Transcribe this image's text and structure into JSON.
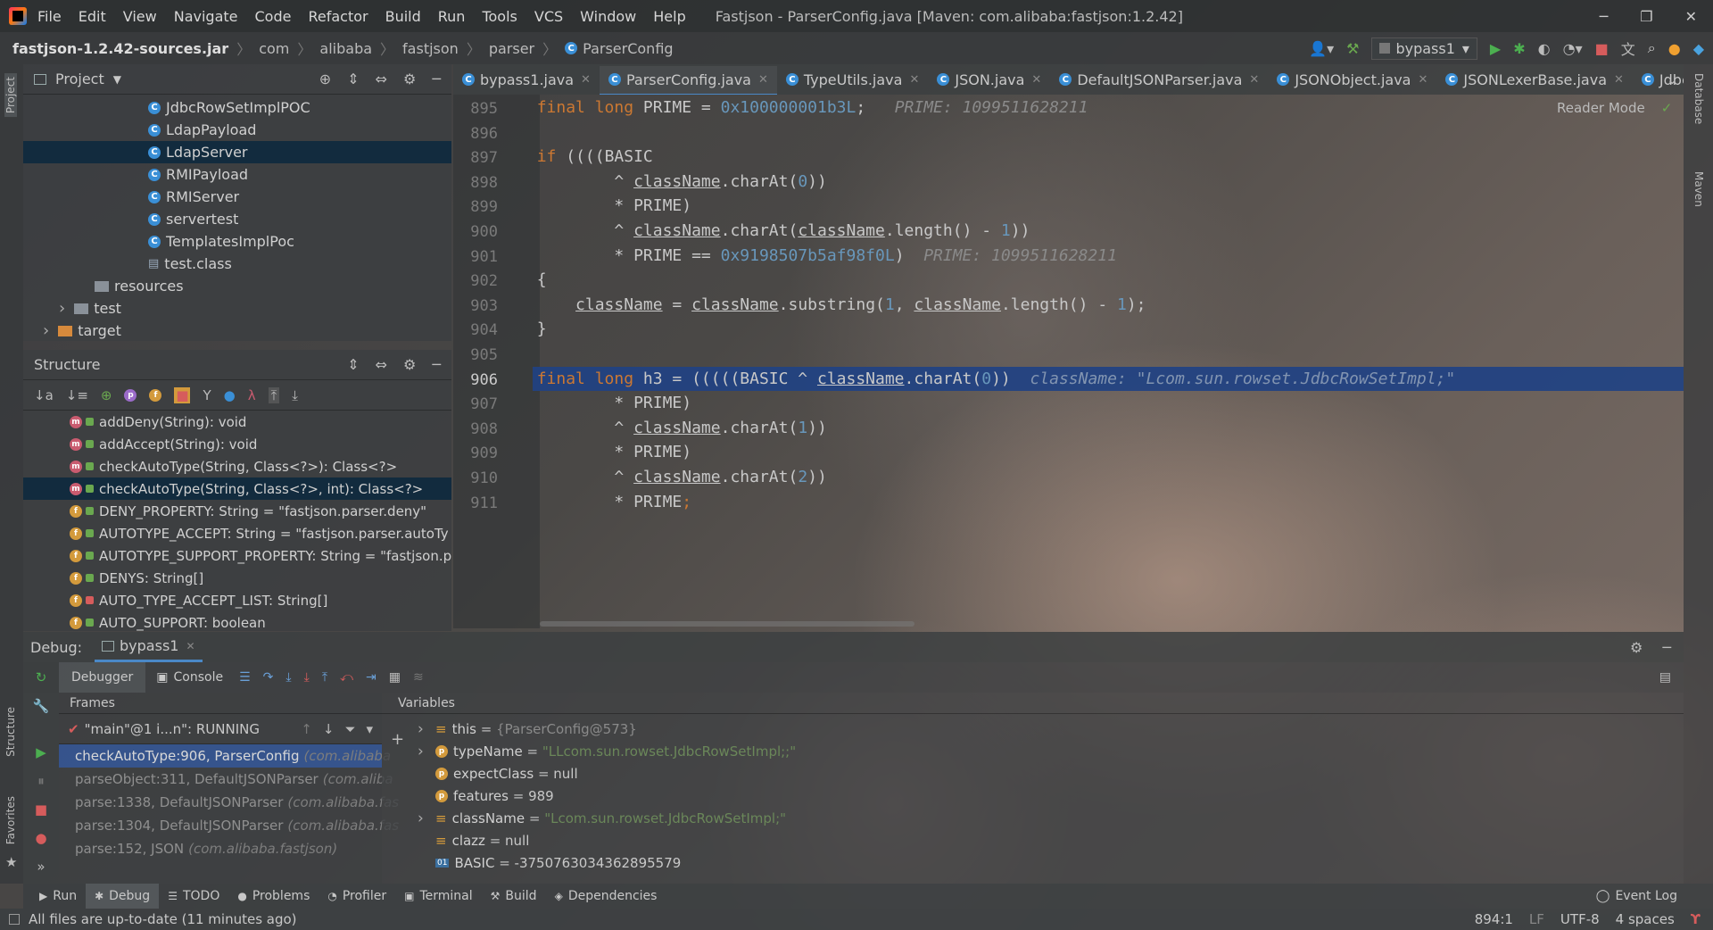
{
  "titlebar": {
    "menu": [
      "File",
      "Edit",
      "View",
      "Navigate",
      "Code",
      "Refactor",
      "Build",
      "Run",
      "Tools",
      "VCS",
      "Window",
      "Help"
    ],
    "title": "Fastjson - ParserConfig.java [Maven: com.alibaba:fastjson:1.2.42]"
  },
  "navbar": {
    "crumbs": [
      "fastjson-1.2.42-sources.jar",
      "com",
      "alibaba",
      "fastjson",
      "parser",
      "ParserConfig"
    ],
    "run_config": "bypass1"
  },
  "project": {
    "title": "Project",
    "items": [
      {
        "label": "JdbcRowSetImplPOC",
        "type": "class",
        "indent": 1
      },
      {
        "label": "LdapPayload",
        "type": "class",
        "indent": 1
      },
      {
        "label": "LdapServer",
        "type": "class",
        "indent": 1,
        "selected": true
      },
      {
        "label": "RMIPayload",
        "type": "class",
        "indent": 1
      },
      {
        "label": "RMIServer",
        "type": "class",
        "indent": 1
      },
      {
        "label": "servertest",
        "type": "class",
        "indent": 1
      },
      {
        "label": "TemplatesImplPoc",
        "type": "class",
        "indent": 1
      },
      {
        "label": "test.class",
        "type": "file",
        "indent": 1
      },
      {
        "label": "resources",
        "type": "folder",
        "indent": 0
      },
      {
        "label": "test",
        "type": "folder",
        "indent": -1
      },
      {
        "label": "target",
        "type": "folder-orange",
        "indent": -2
      }
    ]
  },
  "structure": {
    "title": "Structure",
    "items": [
      {
        "label": "addDeny(String): void",
        "kind": "m"
      },
      {
        "label": "addAccept(String): void",
        "kind": "m"
      },
      {
        "label": "checkAutoType(String, Class<?>): Class<?>",
        "kind": "m"
      },
      {
        "label": "checkAutoType(String, Class<?>, int): Class<?>",
        "kind": "m",
        "selected": true
      },
      {
        "label": "DENY_PROPERTY: String = \"fastjson.parser.deny\"",
        "kind": "f"
      },
      {
        "label": "AUTOTYPE_ACCEPT: String = \"fastjson.parser.autoTy",
        "kind": "f"
      },
      {
        "label": "AUTOTYPE_SUPPORT_PROPERTY: String = \"fastjson.p",
        "kind": "f"
      },
      {
        "label": "DENYS: String[]",
        "kind": "f"
      },
      {
        "label": "AUTO_TYPE_ACCEPT_LIST: String[]",
        "kind": "f",
        "private": true
      },
      {
        "label": "AUTO_SUPPORT: boolean",
        "kind": "f"
      }
    ]
  },
  "tabs": [
    {
      "label": "bypass1.java",
      "active": false
    },
    {
      "label": "ParserConfig.java",
      "active": true
    },
    {
      "label": "TypeUtils.java",
      "active": false
    },
    {
      "label": "JSON.java",
      "active": false
    },
    {
      "label": "DefaultJSONParser.java",
      "active": false
    },
    {
      "label": "JSONObject.java",
      "active": false
    },
    {
      "label": "JSONLexerBase.java",
      "active": false
    },
    {
      "label": "JdbcRo",
      "active": false
    }
  ],
  "editor": {
    "reader_mode": "Reader Mode",
    "lines": [
      {
        "n": "895",
        "html": "        <span class='kw'>final long</span> PRIME = <span class='num'>0x100000001b3L</span>;   <span class='hint'>PRIME: 1099511628211</span>"
      },
      {
        "n": "896",
        "html": ""
      },
      {
        "n": "897",
        "html": "        <span class='kw'>if</span> ((((BASIC"
      },
      {
        "n": "898",
        "html": "                ^ <span class='var'>className</span>.charAt(<span class='num'>0</span>))"
      },
      {
        "n": "899",
        "html": "                * PRIME)"
      },
      {
        "n": "900",
        "html": "                ^ <span class='var'>className</span>.charAt(<span class='var'>className</span>.length() - <span class='num'>1</span>))"
      },
      {
        "n": "901",
        "html": "                * PRIME == <span class='num'>0x9198507b5af98f0L</span>)  <span class='hint'>PRIME: 1099511628211</span>"
      },
      {
        "n": "902",
        "html": "        {"
      },
      {
        "n": "903",
        "html": "            <span class='var'>className</span> = <span class='var'>className</span>.substring(<span class='num'>1</span>, <span class='var'>className</span>.length() - <span class='num'>1</span>);"
      },
      {
        "n": "904",
        "html": "        }"
      },
      {
        "n": "905",
        "html": ""
      },
      {
        "n": "906",
        "html": "        <span class='kw'>final long</span> h3 = (((((BASIC ^ <span class='var'>className</span>.charAt(<span class='num'>0</span>))  <span class='hintb'>className: \"Lcom.sun.rowset.JdbcRowSetImpl;\"</span>",
        "current": true
      },
      {
        "n": "907",
        "html": "                * PRIME)"
      },
      {
        "n": "908",
        "html": "                ^ <span class='var'>className</span>.charAt(<span class='num'>1</span>))"
      },
      {
        "n": "909",
        "html": "                * PRIME)"
      },
      {
        "n": "910",
        "html": "                ^ <span class='var'>className</span>.charAt(<span class='num'>2</span>))"
      },
      {
        "n": "911",
        "html": "                * PRIME<span class='kw'>;</span>"
      }
    ]
  },
  "debug": {
    "label": "Debug:",
    "session": "bypass1",
    "tab_debugger": "Debugger",
    "tab_console": "Console",
    "frames_title": "Frames",
    "variables_title": "Variables",
    "thread": "\"main\"@1 i...n\": RUNNING",
    "frames": [
      {
        "method": "checkAutoType:906, ParserConfig",
        "pkg": "(com.alibaba",
        "selected": true
      },
      {
        "method": "parseObject:311, DefaultJSONParser",
        "pkg": "(com.aliba",
        "selected": false
      },
      {
        "method": "parse:1338, DefaultJSONParser",
        "pkg": "(com.alibaba.fas",
        "selected": false
      },
      {
        "method": "parse:1304, DefaultJSONParser",
        "pkg": "(com.alibaba.fas",
        "selected": false
      },
      {
        "method": "parse:152, JSON",
        "pkg": "(com.alibaba.fastjson)",
        "selected": false
      }
    ],
    "variables": [
      {
        "name": "this",
        "value": "{ParserConfig@573}",
        "kind": "obj",
        "expand": true
      },
      {
        "name": "typeName",
        "value": "\"LLcom.sun.rowset.JdbcRowSetImpl;;\"",
        "kind": "p",
        "expand": true,
        "str": true
      },
      {
        "name": "expectClass",
        "value": "null",
        "kind": "p",
        "expand": false
      },
      {
        "name": "features",
        "value": "989",
        "kind": "p",
        "expand": false
      },
      {
        "name": "className",
        "value": "\"Lcom.sun.rowset.JdbcRowSetImpl;\"",
        "kind": "obj",
        "expand": true,
        "str": true
      },
      {
        "name": "clazz",
        "value": "null",
        "kind": "obj",
        "expand": false
      },
      {
        "name": "BASIC",
        "value": "-3750763034362895579",
        "kind": "01",
        "expand": false
      }
    ]
  },
  "bottom_tabs": [
    {
      "label": "Run",
      "icon": "▶",
      "active": false
    },
    {
      "label": "Debug",
      "icon": "✱",
      "active": true
    },
    {
      "label": "TODO",
      "icon": "☰",
      "active": false
    },
    {
      "label": "Problems",
      "icon": "●",
      "active": false
    },
    {
      "label": "Profiler",
      "icon": "◔",
      "active": false
    },
    {
      "label": "Terminal",
      "icon": "▣",
      "active": false
    },
    {
      "label": "Build",
      "icon": "⚒",
      "active": false
    },
    {
      "label": "Dependencies",
      "icon": "◈",
      "active": false
    }
  ],
  "event_log": "Event Log",
  "status": {
    "message": "All files are up-to-date (11 minutes ago)",
    "position": "894:1",
    "line_sep": "LF",
    "encoding": "UTF-8",
    "indent": "4 spaces"
  },
  "side": {
    "project": "Project",
    "structure": "Structure",
    "favorites": "Favorites",
    "database": "Database",
    "maven": "Maven"
  },
  "colors": {
    "keyword": "#cc7832",
    "number": "#6897bb",
    "string": "#6a8759",
    "selection": "#2f65ca",
    "accent": "#4a88c7"
  }
}
